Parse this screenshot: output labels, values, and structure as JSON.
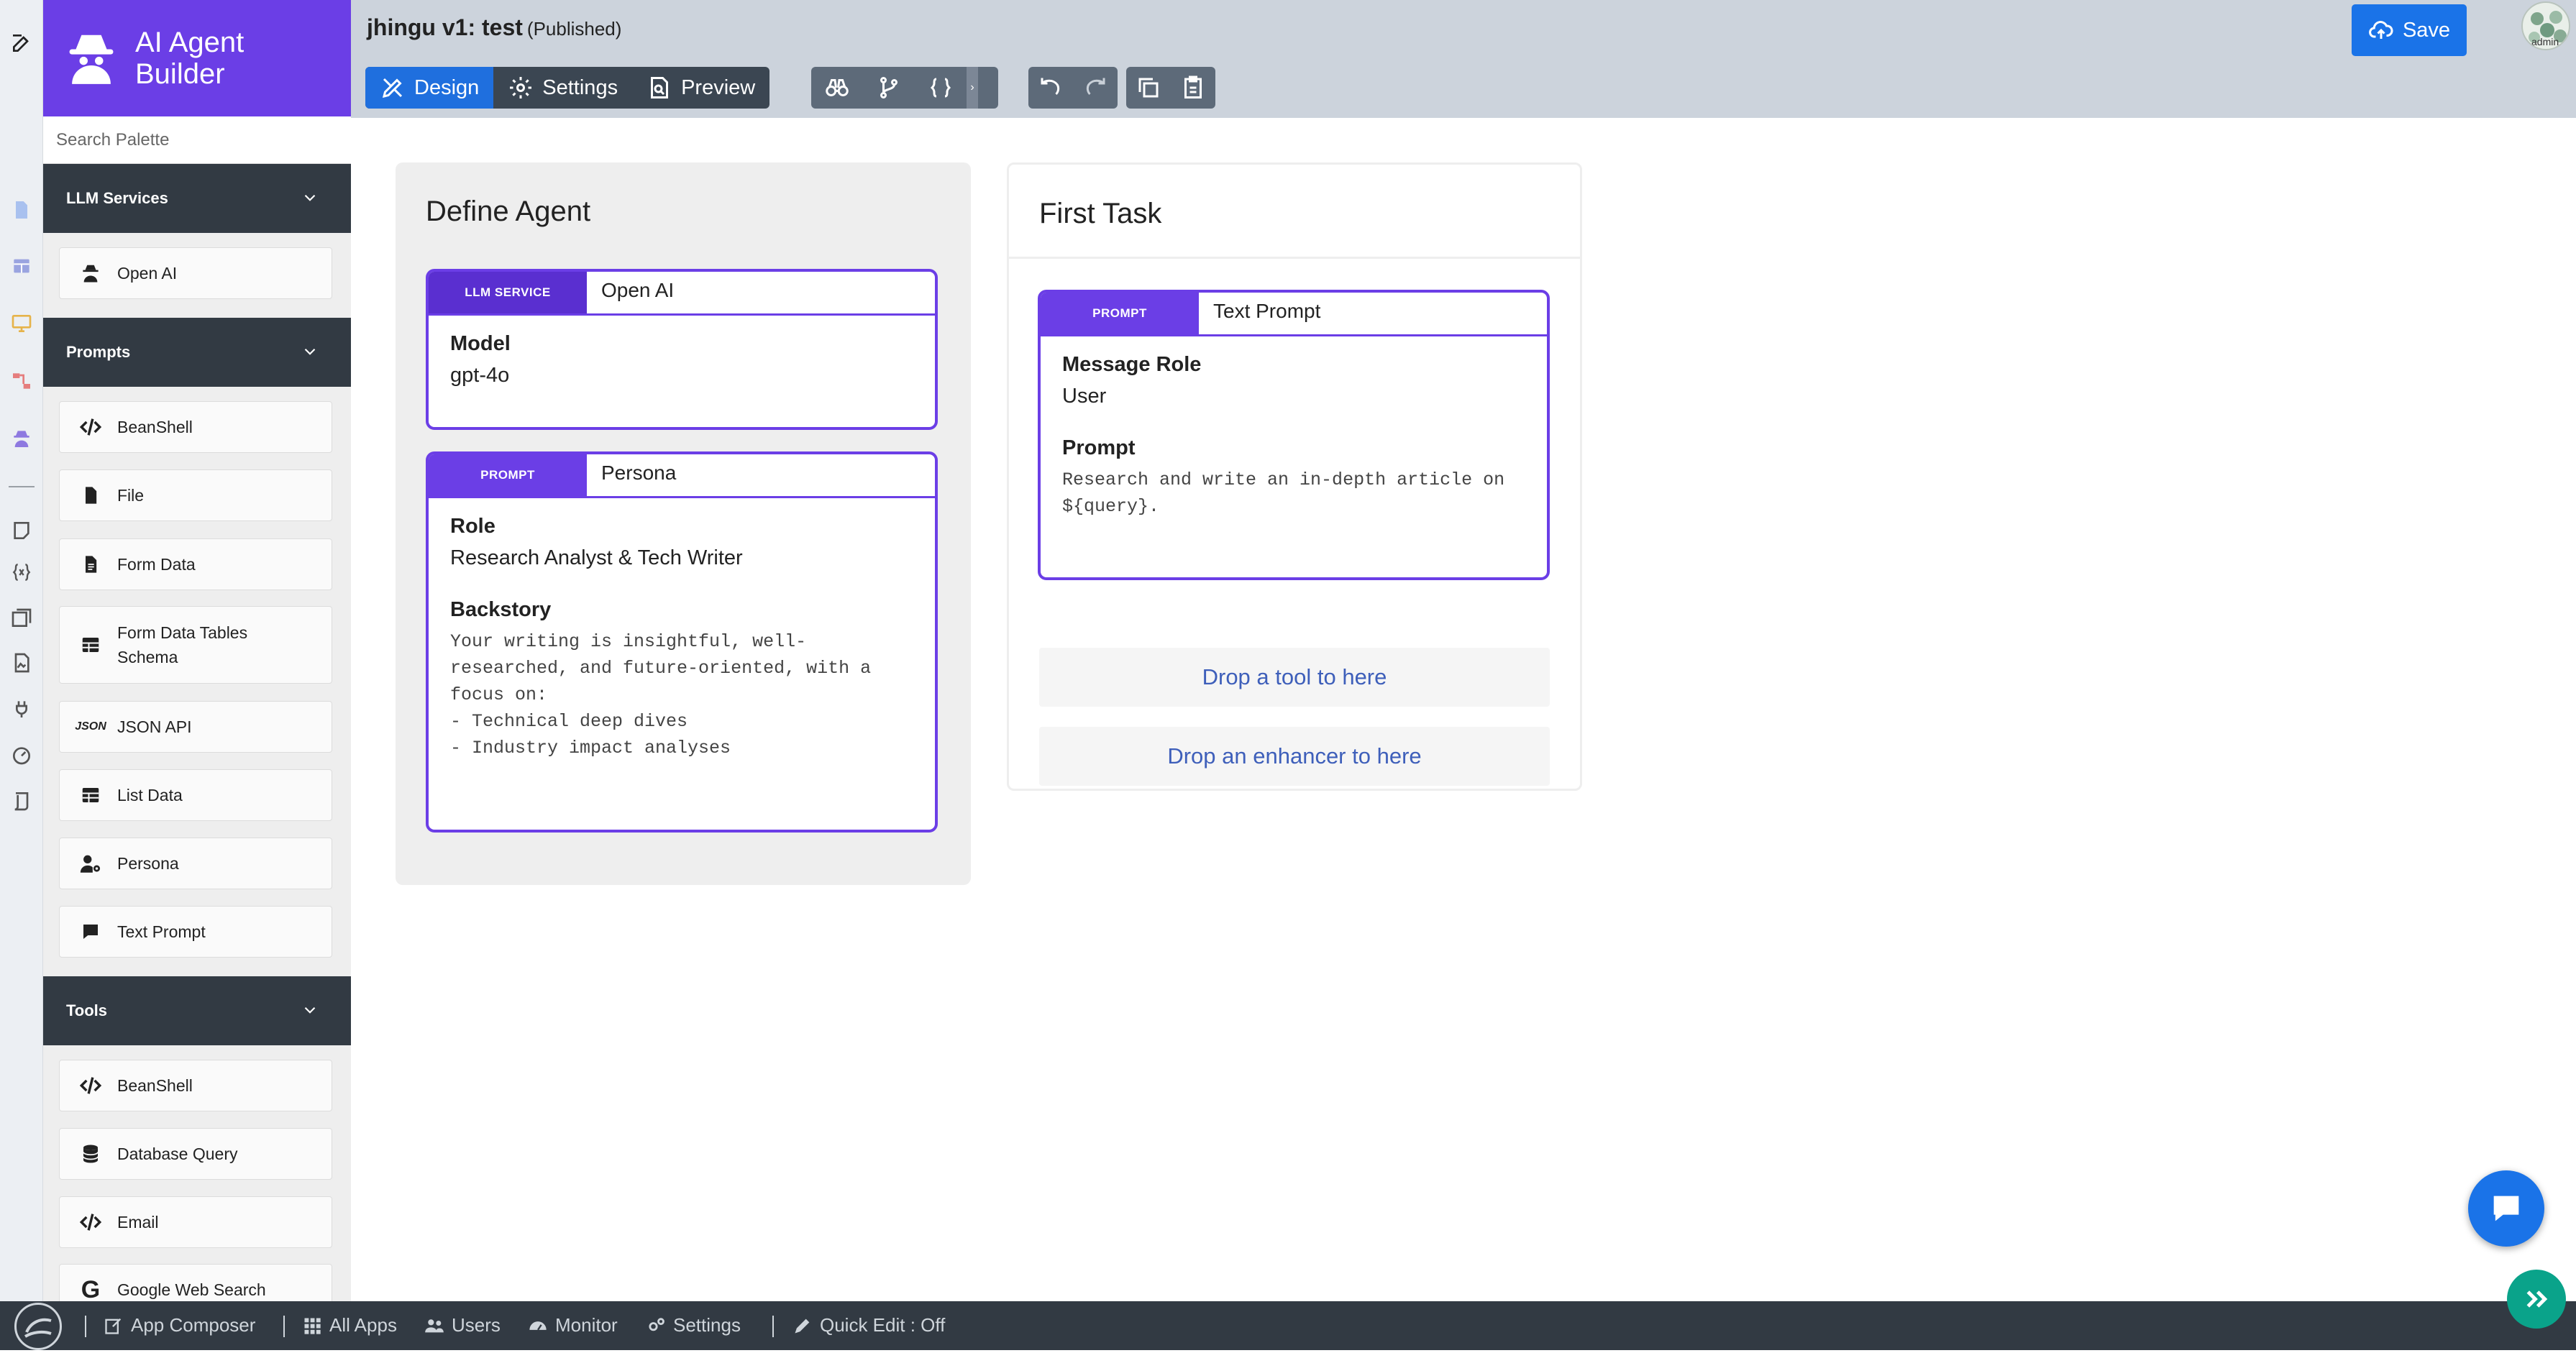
{
  "brand": {
    "title": "AI Agent Builder",
    "logo_icon": "spy-agent-icon"
  },
  "search": {
    "placeholder": "Search Palette"
  },
  "palette": {
    "sections": [
      {
        "title": "LLM Services",
        "items": [
          {
            "label": "Open AI",
            "icon": "spy-agent-icon"
          }
        ]
      },
      {
        "title": "Prompts",
        "items": [
          {
            "label": "BeanShell",
            "icon": "code-icon"
          },
          {
            "label": "File",
            "icon": "file-icon"
          },
          {
            "label": "Form Data",
            "icon": "document-icon"
          },
          {
            "label": "Form Data Tables Schema",
            "icon": "table-icon"
          },
          {
            "label": "JSON API",
            "icon": "json-icon",
            "icon_text": "JSON"
          },
          {
            "label": "List Data",
            "icon": "table-icon"
          },
          {
            "label": "Persona",
            "icon": "user-gear-icon"
          },
          {
            "label": "Text Prompt",
            "icon": "chat-bubble-icon"
          }
        ]
      },
      {
        "title": "Tools",
        "items": [
          {
            "label": "BeanShell",
            "icon": "code-icon"
          },
          {
            "label": "Database Query",
            "icon": "database-icon"
          },
          {
            "label": "Email",
            "icon": "code-icon"
          },
          {
            "label": "Google Web Search",
            "icon": "google-icon"
          }
        ]
      }
    ]
  },
  "header": {
    "app_name": "jhingu v1: test",
    "status": "(Published)",
    "tabs": [
      {
        "label": "Design",
        "active": true
      },
      {
        "label": "Settings"
      },
      {
        "label": "Preview"
      }
    ],
    "save_label": "Save"
  },
  "define_agent": {
    "title": "Define Agent",
    "llm_card": {
      "tab": "LLM SERVICE",
      "name": "Open AI",
      "field_label": "Model",
      "field_value": "gpt-4o"
    },
    "persona_card": {
      "tab": "PROMPT",
      "name": "Persona",
      "role_label": "Role",
      "role_value": "Research Analyst & Tech Writer",
      "backstory_label": "Backstory",
      "backstory_value": "Your writing is insightful, well-\nresearched, and future-oriented, with a\nfocus on:\n- Technical deep dives\n- Industry impact analyses"
    }
  },
  "first_task": {
    "title": "First Task",
    "prompt_card": {
      "tab": "PROMPT",
      "name": "Text Prompt",
      "role_label": "Message Role",
      "role_value": "User",
      "prompt_label": "Prompt",
      "prompt_value": "Research and write an in-depth article on\n${query}."
    },
    "drop_tool": "Drop a tool to here",
    "drop_enhancer": "Drop an enhancer to here"
  },
  "bottom_bar": {
    "items": [
      {
        "label": "App Composer",
        "icon": "edit-icon"
      },
      {
        "label": "All Apps",
        "icon": "grid-icon"
      },
      {
        "label": "Users",
        "icon": "users-icon"
      },
      {
        "label": "Monitor",
        "icon": "gauge-icon"
      },
      {
        "label": "Settings",
        "icon": "gears-icon"
      },
      {
        "label": "Quick Edit : Off",
        "icon": "pencil-icon"
      }
    ]
  },
  "avatar": {
    "label": "admin"
  },
  "colors": {
    "brand": "#6b3ee6",
    "accent_blue": "#1a73e8",
    "dark_bar": "#323a43",
    "header_bg": "#ccd3dc",
    "teal": "#0aa38a"
  }
}
